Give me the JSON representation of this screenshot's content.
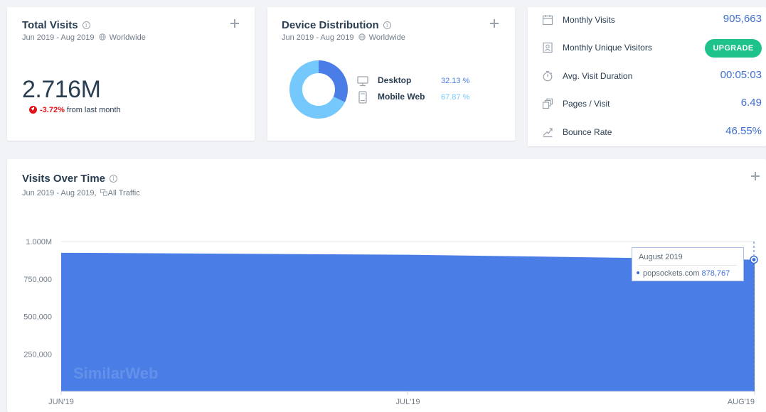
{
  "total_visits": {
    "title": "Total Visits",
    "info": "i",
    "date_range": "Jun 2019 - Aug 2019",
    "region": "Worldwide",
    "value": "2.716M",
    "change": "-3.72%",
    "change_text": "from last month"
  },
  "device_distribution": {
    "title": "Device Distribution",
    "info": "i",
    "date_range": "Jun 2019 - Aug 2019",
    "region": "Worldwide",
    "devices": [
      {
        "label": "Desktop",
        "value": "32.13 %",
        "share": 32.13,
        "color": "#4a7ee6",
        "icon": "desktop-icon"
      },
      {
        "label": "Mobile Web",
        "value": "67.87 %",
        "share": 67.87,
        "color": "#75c8fb",
        "icon": "mobile-icon"
      }
    ]
  },
  "metrics": [
    {
      "label": "Monthly Visits",
      "value": "905,663",
      "icon": "calendar-icon"
    },
    {
      "label": "Monthly Unique Visitors",
      "button": "UPGRADE",
      "icon": "person-card-icon"
    },
    {
      "label": "Avg. Visit Duration",
      "value": "00:05:03",
      "icon": "stopwatch-icon"
    },
    {
      "label": "Pages / Visit",
      "value": "6.49",
      "icon": "pages-icon"
    },
    {
      "label": "Bounce Rate",
      "value": "46.55%",
      "icon": "bounce-arrow-icon"
    }
  ],
  "visits_over_time": {
    "title": "Visits Over Time",
    "info": "i",
    "date_range": "Jun 2019 - Aug 2019,",
    "traffic": "All Traffic",
    "watermark": "SimilarWeb",
    "tooltip": {
      "title": "August 2019",
      "site": "popsockets.com",
      "value": "878,767"
    }
  },
  "chart_data": {
    "type": "area",
    "x": [
      "JUN'19",
      "JUL'19",
      "AUG'19"
    ],
    "series": [
      {
        "name": "popsockets.com",
        "values": [
          925000,
          912000,
          878767
        ],
        "color": "#4a7ee6"
      }
    ],
    "y_ticks": [
      "1.000M",
      "750,000",
      "500,000",
      "250,000"
    ],
    "y_tick_values": [
      1000000,
      750000,
      500000,
      250000
    ],
    "ylim": [
      0,
      1000000
    ],
    "grid": true,
    "legend": "none"
  },
  "colors": {
    "accent": "#3f6fd1",
    "negative": "#e2131a",
    "upgrade": "#1ec28b",
    "area": "#4a7ee6"
  }
}
